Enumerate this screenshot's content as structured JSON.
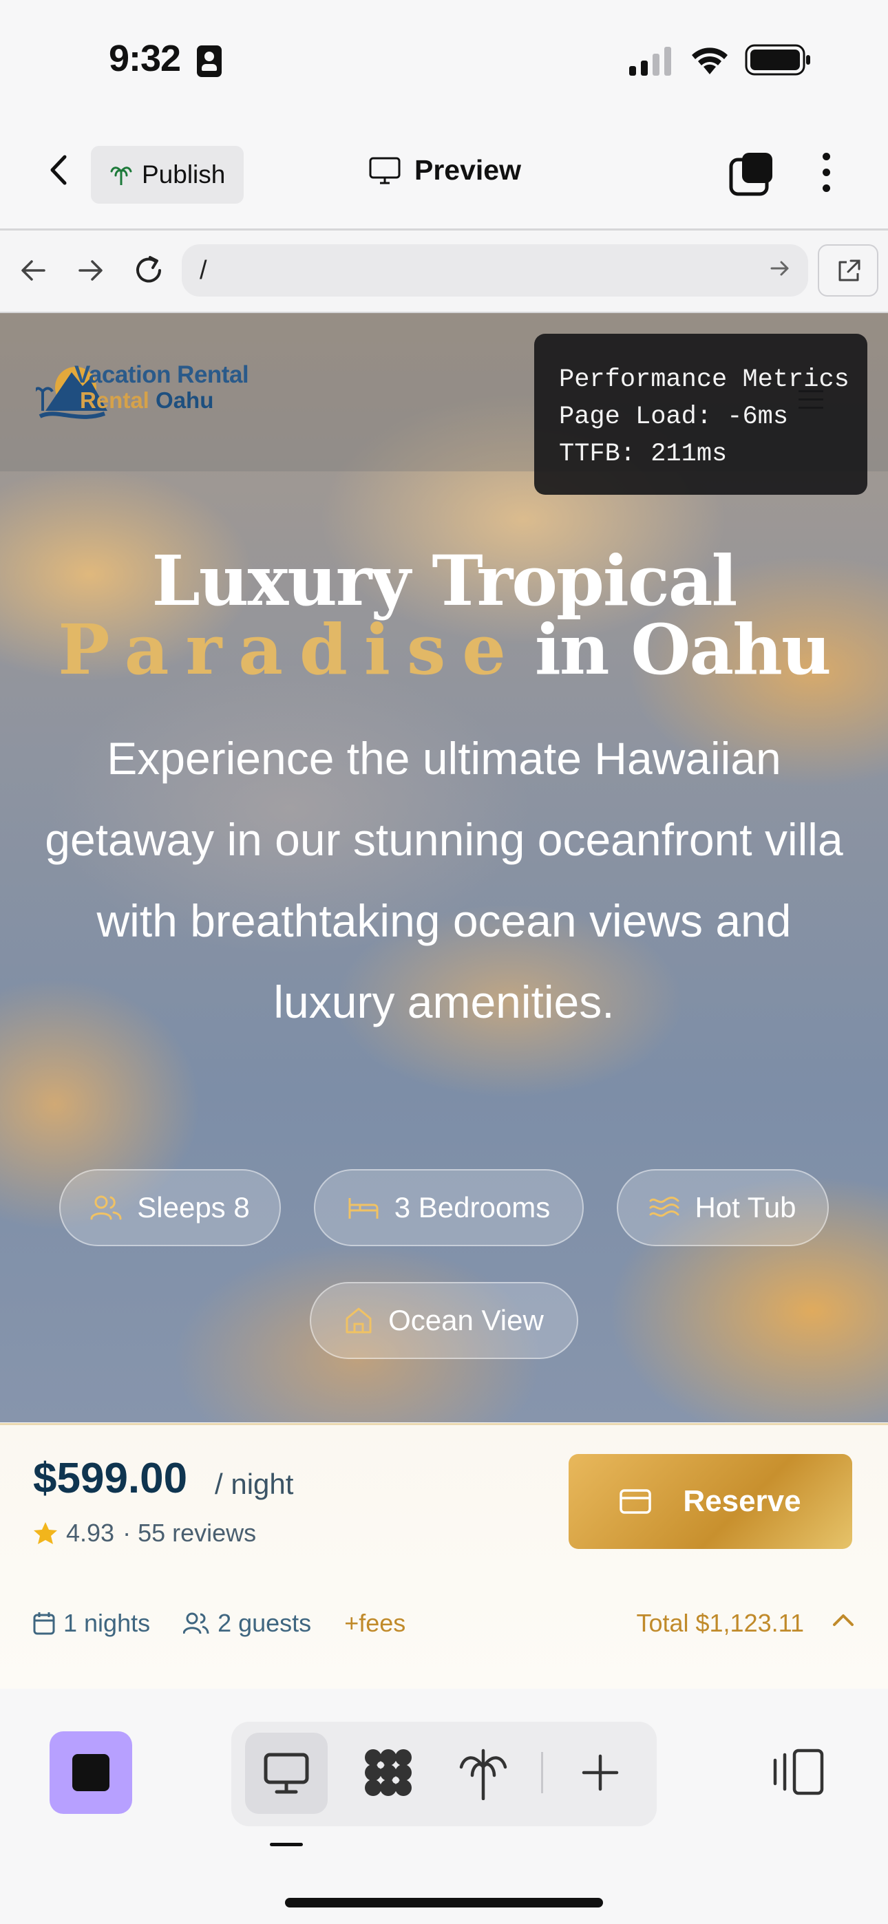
{
  "status_bar": {
    "time": "9:32"
  },
  "app_bar": {
    "publish_label": "Publish",
    "preview_label": "Preview"
  },
  "browser": {
    "url": "/"
  },
  "site": {
    "logo_line1": "Vacation Rental",
    "logo_line2a": "Rental",
    "logo_line2b": "Oahu",
    "perf": {
      "title": "Performance Metrics",
      "page_load": "Page Load: -6ms",
      "ttfb": "TTFB: 211ms"
    },
    "hero": {
      "title_line1": "Luxury Tropical",
      "title_highlight": "Paradise",
      "title_line2_rest": "in Oahu",
      "subtitle": "Experience the ultimate Hawaiian getaway in our stunning oceanfront villa with breathtaking ocean views and luxury amenities."
    },
    "chips": [
      {
        "label": "Sleeps 8",
        "icon": "users-icon"
      },
      {
        "label": "3 Bedrooms",
        "icon": "bed-icon"
      },
      {
        "label": "Hot Tub",
        "icon": "waves-icon"
      },
      {
        "label": "Ocean View",
        "icon": "home-icon"
      }
    ],
    "booking": {
      "price": "$599.00",
      "per": "/ night",
      "rating": "4.93",
      "reviews": "· 55 reviews",
      "reserve_label": "Reserve",
      "nights": "1 nights",
      "guests": "2 guests",
      "fees": "+fees",
      "total": "Total $1,123.11"
    }
  },
  "colors": {
    "accent_gold": "#c08a2a",
    "price_navy": "#0f3550",
    "stop_purple": "#b7a0ff"
  }
}
